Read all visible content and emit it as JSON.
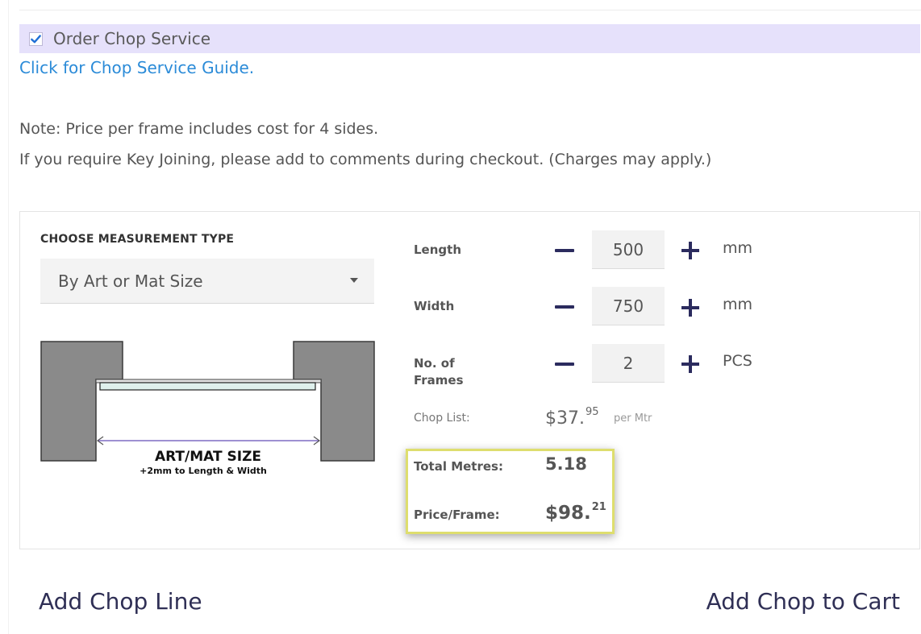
{
  "chop_service": {
    "checkbox_checked": true,
    "label": "Order Chop Service",
    "guide_link": "Click for Chop Service Guide."
  },
  "notes": {
    "line1": "Note: Price per frame includes cost for 4 sides.",
    "line2": "If you require Key Joining, please add to comments during checkout. (Charges may apply.)"
  },
  "measurement": {
    "heading": "CHOOSE MEASUREMENT TYPE",
    "selected": "By Art or Mat Size"
  },
  "diagram": {
    "main_label": "ART/MAT SIZE",
    "sub_label": "+2mm to Length & Width"
  },
  "fields": {
    "length": {
      "label": "Length",
      "value": "500",
      "unit": "mm"
    },
    "width": {
      "label": "Width",
      "value": "750",
      "unit": "mm"
    },
    "frames": {
      "label_line1": "No. of",
      "label_line2": "Frames",
      "value": "2",
      "unit": "PCS"
    }
  },
  "chop_list": {
    "label": "Chop List:",
    "price_main": "$37.",
    "price_cents": "95",
    "per": "per Mtr"
  },
  "summary": {
    "total_label": "Total Metres:",
    "total_value": "5.18",
    "price_label": "Price/Frame:",
    "price_main": "$98.",
    "price_cents": "21"
  },
  "actions": {
    "add_line": "Add Chop Line",
    "add_cart": "Add Chop to Cart"
  },
  "colors": {
    "accent_bar": "#e6e1fb",
    "link": "#2b8bd8",
    "highlight_border": "#dede6e",
    "button_text": "#2f2f55"
  }
}
